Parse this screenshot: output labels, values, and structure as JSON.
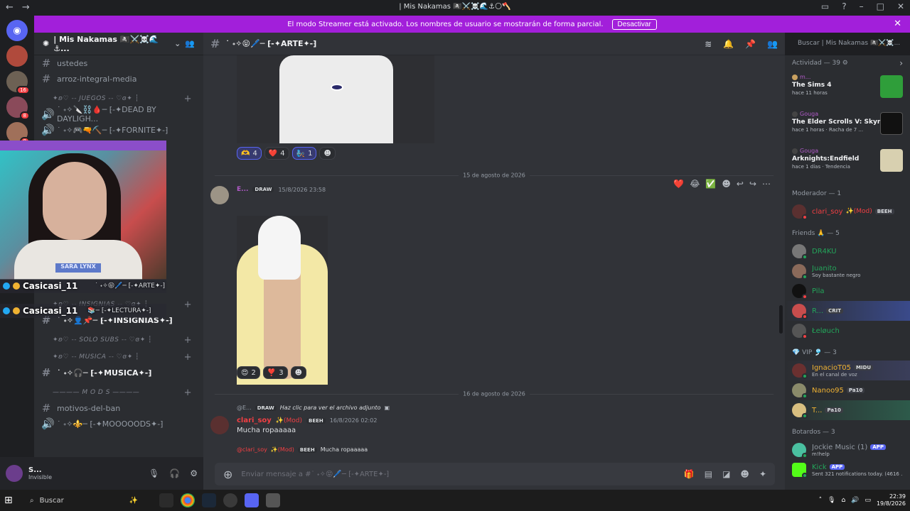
{
  "window": {
    "title": "| Mis Nakamas 🏴‍☠️⚔️☠️🌊⚓🌕🪓"
  },
  "banner": {
    "text": "El modo Streamer está activado. Los nombres de usuario se mostrarán de forma parcial.",
    "button": "Desactivar"
  },
  "guild_badges": [
    "16",
    "8",
    "8"
  ],
  "server": {
    "name": "| Mis Nakamas 🏴‍☠️⚔️☠️🌊⚓..."
  },
  "channels": {
    "top": [
      {
        "name": "ustedes"
      },
      {
        "name": "arroz-integral-media"
      }
    ],
    "cat_juegos": "✦ʚ♡ -- JUEGOS -- ♡ɞ✦ ┆",
    "juegos": [
      {
        "name": "˙ ˖✧🔪⛓️🩸─ ⁅-✦DEAD BY DAYLIGH..."
      },
      {
        "name": "˙ ˖✧🎮🔫⛏️─ ⁅-✦FORNITE✦-⁆"
      }
    ],
    "cat_insignias": "✦ʚ♡ -- INSIGNIAS -- ♡ɞ✦ ┆",
    "insignias": [
      {
        "name": "˙ ˖✧👤📌─ ⁅-✦INSIGNIAS✦-⁆"
      }
    ],
    "cat_solo_subs": "✦ʚ♡ -- SOLO SUBS -- ♡ɞ✦ ┆",
    "cat_musica": "✦ʚ♡ -- MUSICA -- ♡ɞ✦ ┆",
    "musica": [
      {
        "name": "˙ ˖✧🎧─ ⁅-✦MUSICA✦-⁆"
      }
    ],
    "cat_mods": "———— M O D S ————",
    "mods": [
      {
        "name": "motivos-del-ban"
      },
      {
        "name": "˙ ˖✧⚜️─ ⁅-✦MOOOOODS✦-⁆"
      }
    ]
  },
  "stream_overlay": {
    "plaque": "SARA LYNX",
    "line1": "Casicasi_11",
    "line2": "Casicasi_11",
    "ch1": "˙ ˖✧😝🖊️─ ⁅-✦ARTE✦-⁆",
    "ch2": "📚─ ⁅-✦LECTURA✦-⁆"
  },
  "user": {
    "name": "S...",
    "status": "Invisible"
  },
  "channel_header": {
    "name": "˙ ˖✧😝🖊️─ ⁅-✦ARTE✦-⁆"
  },
  "search": {
    "placeholder": "Buscar | Mis Nakamas 🏴‍☠️⚔️☠️..."
  },
  "messages": {
    "react_row1": [
      {
        "e": "🫶",
        "n": "4"
      },
      {
        "e": "❤️",
        "n": "4"
      },
      {
        "e": "🧞",
        "n": "1"
      }
    ],
    "date1": "15 de agosto de 2026",
    "msg1": {
      "name": "E...",
      "tag": "DRAW",
      "time": "15/8/2026 23:58"
    },
    "react_row2": [
      {
        "e": "😍",
        "n": "2"
      },
      {
        "e": "❣️",
        "n": "3"
      }
    ],
    "date2": "16 de agosto de 2026",
    "reply1": {
      "name": "@E...",
      "tag": "DRAW",
      "text": "Haz clic para ver el archivo adjunto"
    },
    "msg2": {
      "name": "clari_soy",
      "mod": "✨(Mod)",
      "tag": "BEEH",
      "time": "16/8/2026 02:02",
      "text": "Mucha ropaaaaa"
    },
    "reply2": {
      "name": "@clari_soy",
      "mod": "✨(Mod)",
      "tag": "BEEH",
      "text": "Mucha ropaaaaa"
    }
  },
  "composer": {
    "placeholder": "Enviar mensaje a #˙ ˖✧😝🖊️─ ⁅-✦ARTE✦-⁆"
  },
  "activity": {
    "header": "Actividad — 39",
    "items": [
      {
        "who": "m...",
        "game": "The Sims 4",
        "meta": "hace 11 horas"
      },
      {
        "who": "Gouga",
        "game": "The Elder Scrolls V: Skyrim...",
        "meta": "hace 1 horas · Racha de 7 ..."
      },
      {
        "who": "Gouga",
        "game": "Arknights:Endfield",
        "meta": "hace 1 días · Tendencia"
      }
    ]
  },
  "groups": {
    "moderador": "Moderador — 1",
    "friends": "Friends 🙏 — 5",
    "vip": "💎 VIP 🎐 — 3",
    "bots": "Botardos — 3"
  },
  "members": {
    "mod": [
      {
        "name": "clari_soy",
        "extra": "✨(Mod)",
        "tag": "BEEH",
        "color": "#f23f43"
      }
    ],
    "friends": [
      {
        "name": "DR4KU",
        "sub": "",
        "color": "#23a55a"
      },
      {
        "name": "Juanito",
        "sub": "Soy bastante negro",
        "color": "#23a55a"
      },
      {
        "name": "Pila",
        "sub": "",
        "color": "#23a55a"
      },
      {
        "name": "R...",
        "sub": "",
        "tag": "CRIT",
        "color": "#23a55a"
      },
      {
        "name": "Łeløuch",
        "sub": "",
        "color": "#23a55a"
      }
    ],
    "vip": [
      {
        "name": "IgnacioT05",
        "sub": "En el canal de voz",
        "tag": "MIDU",
        "color": "#f0b232"
      },
      {
        "name": "Nanoo95",
        "sub": "",
        "tag": "Pa10",
        "color": "#f0b232"
      },
      {
        "name": "T...",
        "sub": "",
        "tag": "Pa10",
        "color": "#f0b232"
      }
    ],
    "bots": [
      {
        "name": "Jockie Music (1)",
        "sub": "m!help",
        "tag": "APP",
        "color": "#949ba4"
      },
      {
        "name": "Kick",
        "sub": "Sent 321 notifications today. (4616 ...",
        "tag": "APP",
        "color": "#23a55a"
      }
    ]
  },
  "taskbar": {
    "search": "Buscar",
    "time": "22:39",
    "date": "19/8/2026"
  },
  "colors": {
    "banner": "#a21fda",
    "online": "#23a55a",
    "mod": "#f23f43",
    "blurple": "#5865f2"
  }
}
